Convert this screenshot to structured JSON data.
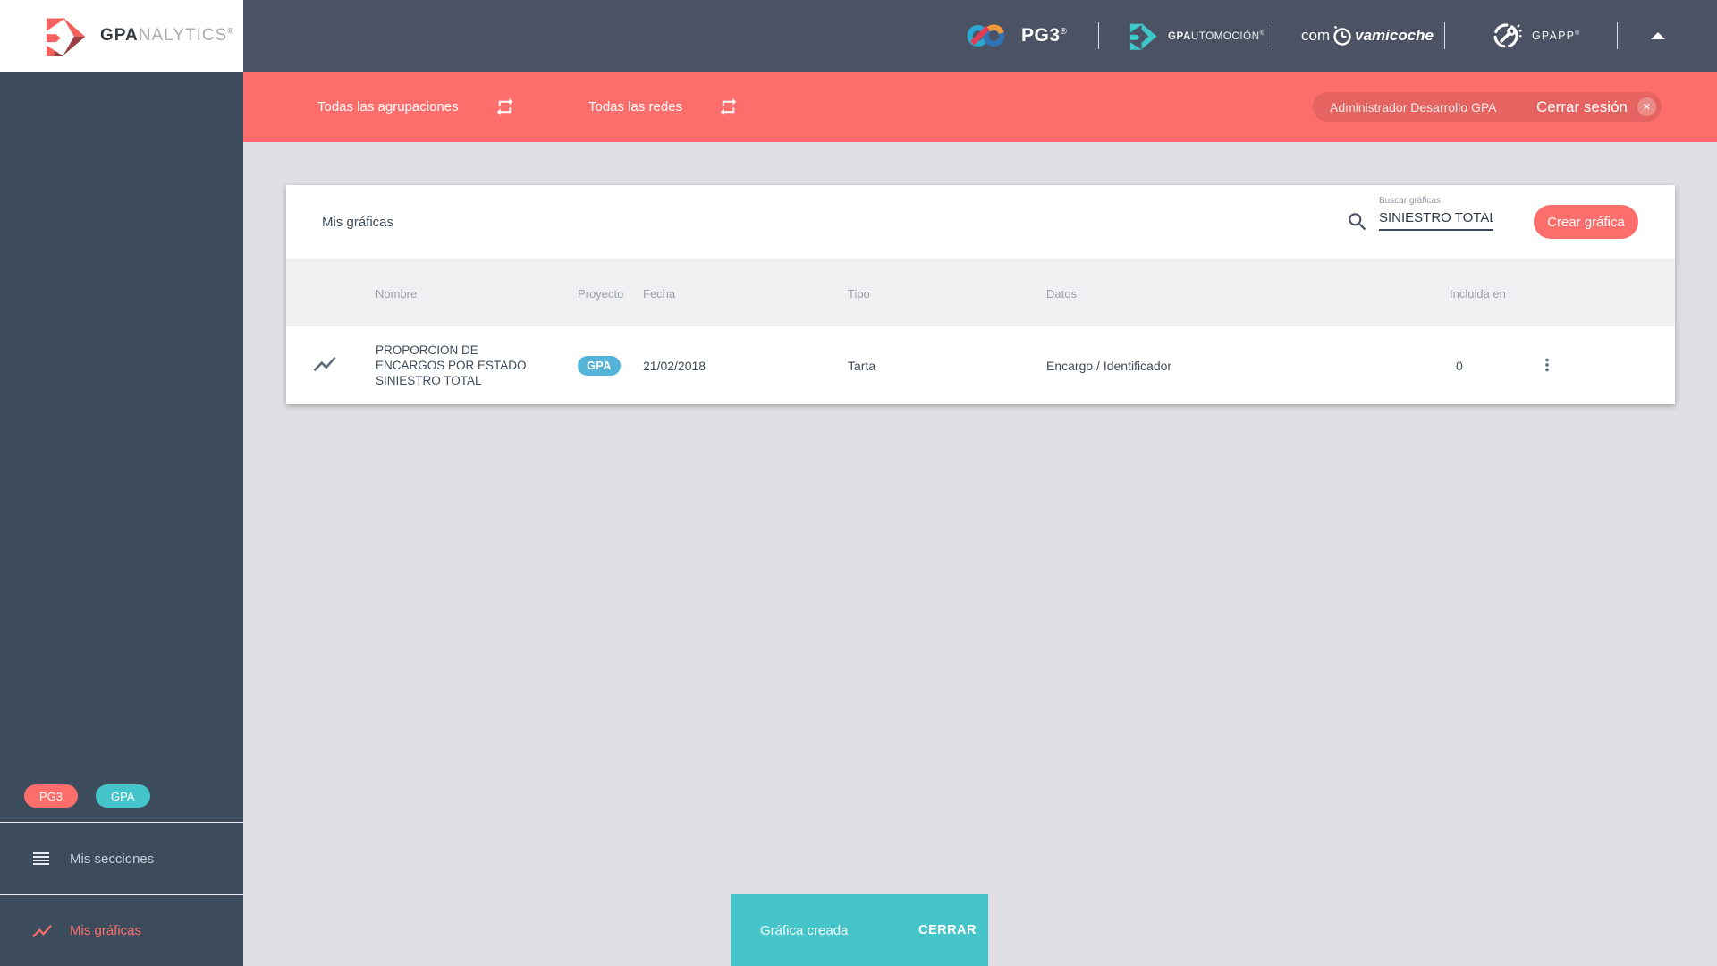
{
  "app": {
    "brand_bold": "GPA",
    "brand_light": "NALYTICS",
    "brand_reg": "®"
  },
  "topbar": {
    "pg3_label": "PG3",
    "pg3_reg": "®",
    "auto_bold": "GPA",
    "auto_rest": "UTOMOCIÓN",
    "auto_reg": "®",
    "com_prefix": "com",
    "com_suffix": "vamicoche",
    "gpapp_label": "GPAPP",
    "gpapp_reg": "®"
  },
  "filter_bar": {
    "groupings_label": "Todas las agrupaciones",
    "networks_label": "Todas las redes",
    "user_name": "Administrador Desarrollo GPA",
    "logout_label": "Cerrar sesión",
    "close_glyph": "✕"
  },
  "sidebar": {
    "badges": [
      {
        "label": "PG3"
      },
      {
        "label": "GPA"
      }
    ],
    "items": [
      {
        "label": "Mis secciones",
        "active": false
      },
      {
        "label": "Mis gráficas",
        "active": true
      }
    ]
  },
  "card": {
    "title": "Mis gráficas",
    "search": {
      "label": "Buscar gráficas",
      "value": "SINIESTRO TOTAL"
    },
    "create_button": "Crear gráfica",
    "table": {
      "columns": [
        "Nombre",
        "Proyecto",
        "Fecha",
        "Tipo",
        "Datos",
        "Incluida en"
      ],
      "rows": [
        {
          "name": "PROPORCION DE ENCARGOS POR ESTADO SINIESTRO TOTAL",
          "project_badge": "GPA",
          "date": "21/02/2018",
          "type": "Tarta",
          "data": "Encargo / Identificador",
          "included_in": "0"
        }
      ]
    }
  },
  "snackbar": {
    "message": "Gráfica creada",
    "action": "CERRAR"
  },
  "colors": {
    "accent_coral": "#fc6e6b",
    "teal": "#45c5c9",
    "badge_blue": "#55b3d8",
    "sidebar_dark": "#3d4c5c",
    "topbar_dark": "#4a5263",
    "text_dark": "#3f4b5b"
  },
  "icons": {
    "search": "magnifier",
    "repeat": "loop-swap-arrows",
    "more": "kebab-vertical-dots",
    "chart": "line-chart-zigzag",
    "menu": "hamburger-lines",
    "close": "x-circle",
    "collapse": "triangle-up",
    "clock": "stopwatch",
    "gpapp": "wrench-in-circle"
  }
}
